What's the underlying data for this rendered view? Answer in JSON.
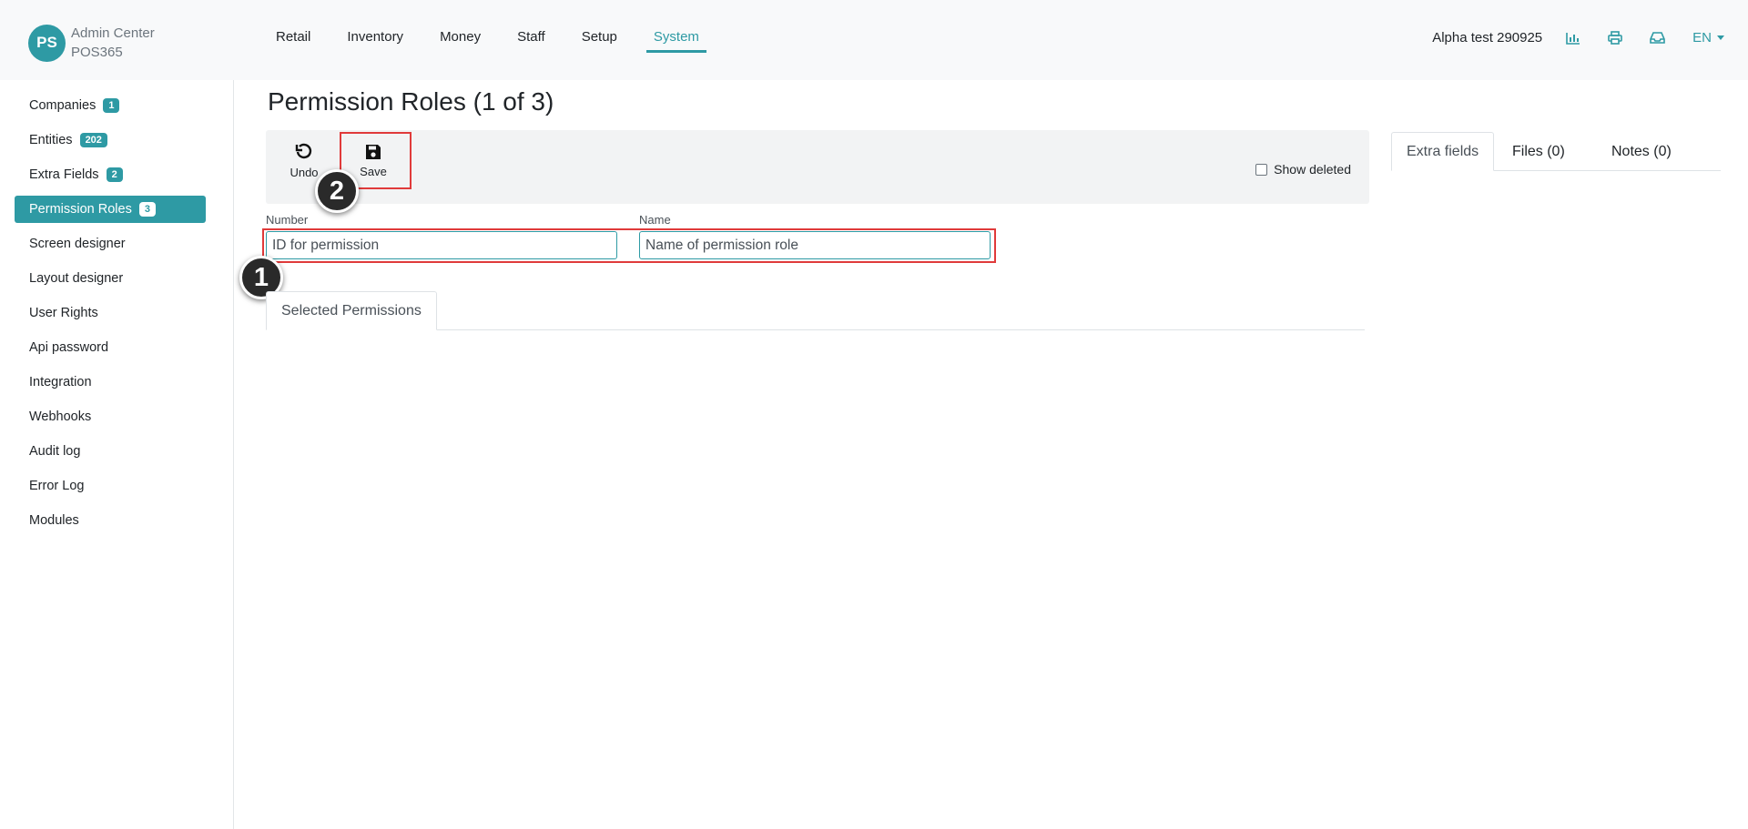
{
  "brand": {
    "initials": "PS",
    "line1": "Admin Center",
    "line2": "POS365"
  },
  "topnav": [
    "Retail",
    "Inventory",
    "Money",
    "Staff",
    "Setup",
    "System"
  ],
  "topnav_active": "System",
  "header_right": {
    "account": "Alpha test 290925",
    "language": "EN",
    "icons": [
      "chart-icon",
      "print-icon",
      "inbox-icon"
    ]
  },
  "sidebar": {
    "items": [
      {
        "label": "Companies",
        "badge": "1"
      },
      {
        "label": "Entities",
        "badge": "202"
      },
      {
        "label": "Extra Fields",
        "badge": "2"
      },
      {
        "label": "Permission Roles",
        "badge": "3"
      },
      {
        "label": "Screen designer"
      },
      {
        "label": "Layout designer"
      },
      {
        "label": "User Rights"
      },
      {
        "label": "Api password"
      },
      {
        "label": "Integration"
      },
      {
        "label": "Webhooks"
      },
      {
        "label": "Audit log"
      },
      {
        "label": "Error Log"
      },
      {
        "label": "Modules"
      }
    ],
    "active": "Permission Roles"
  },
  "page": {
    "title": "Permission Roles (1 of 3)"
  },
  "toolbar": {
    "undo_label": "Undo",
    "save_label": "Save",
    "show_deleted_label": "Show deleted",
    "show_deleted_checked": false
  },
  "form": {
    "number_label": "Number",
    "number_value": "ID for permission",
    "name_label": "Name",
    "name_value": "Name of permission role"
  },
  "tabs": {
    "selected_permissions": "Selected Permissions"
  },
  "right_tabs": [
    "Extra fields",
    "Files (0)",
    "Notes (0)"
  ],
  "right_tabs_active": "Extra fields",
  "annotations": {
    "marker1": "1",
    "marker2": "2",
    "color": "#e03a3a"
  },
  "colors": {
    "accent": "#2e9aa4",
    "header_bg": "#f8f9fa",
    "toolbar_bg": "#f2f3f4"
  }
}
